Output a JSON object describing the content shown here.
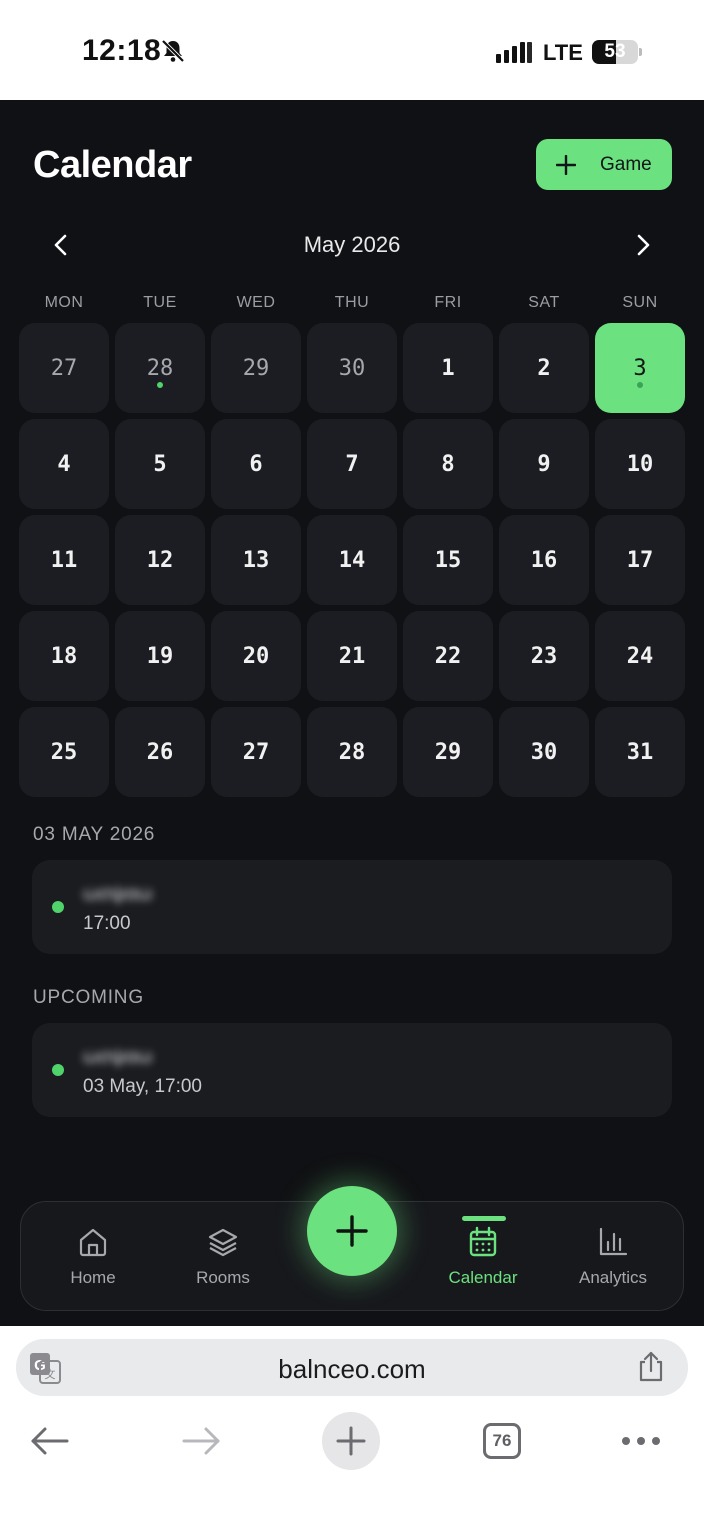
{
  "status_bar": {
    "time": "12:18",
    "network": "LTE",
    "battery_percent": "53",
    "battery_level": 0.53
  },
  "header": {
    "title": "Calendar",
    "add_button_label": "Game"
  },
  "month_nav": {
    "label": "May 2026"
  },
  "weekdays": [
    "MON",
    "TUE",
    "WED",
    "THU",
    "FRI",
    "SAT",
    "SUN"
  ],
  "calendar": {
    "days": [
      {
        "label": "27",
        "muted": true
      },
      {
        "label": "28",
        "muted": true,
        "event_dot": true
      },
      {
        "label": "29",
        "muted": true
      },
      {
        "label": "30",
        "muted": true
      },
      {
        "label": "1"
      },
      {
        "label": "2"
      },
      {
        "label": "3",
        "selected": true,
        "event_dot": true
      },
      {
        "label": "4"
      },
      {
        "label": "5"
      },
      {
        "label": "6"
      },
      {
        "label": "7"
      },
      {
        "label": "8"
      },
      {
        "label": "9"
      },
      {
        "label": "10"
      },
      {
        "label": "11"
      },
      {
        "label": "12"
      },
      {
        "label": "13"
      },
      {
        "label": "14"
      },
      {
        "label": "15"
      },
      {
        "label": "16"
      },
      {
        "label": "17"
      },
      {
        "label": "18"
      },
      {
        "label": "19"
      },
      {
        "label": "20"
      },
      {
        "label": "21"
      },
      {
        "label": "22"
      },
      {
        "label": "23"
      },
      {
        "label": "24"
      },
      {
        "label": "25"
      },
      {
        "label": "26"
      },
      {
        "label": "27"
      },
      {
        "label": "28"
      },
      {
        "label": "29"
      },
      {
        "label": "30"
      },
      {
        "label": "31"
      }
    ]
  },
  "selected_day": {
    "heading": "03 MAY 2026",
    "events": [
      {
        "title": "ωσψαω",
        "time": "17:00"
      }
    ]
  },
  "upcoming": {
    "heading": "UPCOMING",
    "events": [
      {
        "title": "ωσψαω",
        "time": "03 May, 17:00"
      }
    ]
  },
  "tabbar": {
    "tabs": [
      {
        "label": "Home",
        "icon": "home-icon"
      },
      {
        "label": "Rooms",
        "icon": "layers-icon"
      },
      {
        "label": "Calendar",
        "icon": "calendar-icon",
        "active": true
      },
      {
        "label": "Analytics",
        "icon": "bar-chart-icon"
      }
    ]
  },
  "browser": {
    "url": "balnceo.com",
    "tab_count": "76"
  },
  "colors": {
    "accent": "#6be17f",
    "background": "#101114",
    "cell": "#1c1d22"
  }
}
